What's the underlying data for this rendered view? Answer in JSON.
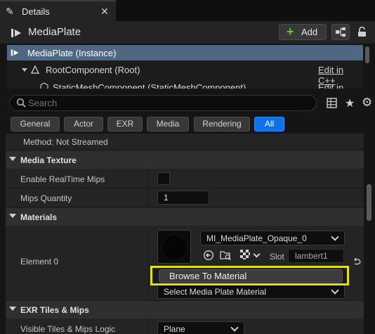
{
  "tab": {
    "title": "Details",
    "icon": "pencil-icon",
    "close": "✕"
  },
  "header": {
    "title": "MediaPlate",
    "add_label": "Add",
    "add_symbol": "+"
  },
  "tree": {
    "rows": [
      {
        "label": "MediaPlate (Instance)",
        "edit": ""
      },
      {
        "label": "RootComponent (Root)",
        "edit": "Edit in C++"
      },
      {
        "label": "StaticMeshComponent (StaticMeshComponent)",
        "edit": "Edit in C++"
      }
    ]
  },
  "search": {
    "placeholder": "Search"
  },
  "filters": [
    "General",
    "Actor",
    "EXR",
    "Media",
    "Rendering",
    "All"
  ],
  "active_filter": "All",
  "properties": {
    "method_text": "Method: Not Streamed",
    "media_texture": {
      "title": "Media Texture",
      "enable_realtime_mips_label": "Enable RealTime Mips",
      "enable_realtime_mips_checked": false,
      "mips_quantity_label": "Mips Quantity",
      "mips_quantity_value": "1"
    },
    "materials": {
      "title": "Materials",
      "element_label": "Element 0",
      "material_value": "MI_MediaPlate_Opaque_0",
      "slot_label": "Slot",
      "slot_value": "lambert1",
      "popup_item": "Browse To Material",
      "select_material_label": "Select Media Plate Material"
    },
    "exr": {
      "title": "EXR Tiles & Mips",
      "visible_tiles_label": "Visible Tiles & Mips Logic",
      "visible_tiles_value": "Plane"
    }
  },
  "colors": {
    "accent": "#0e71e8",
    "selection": "#4f6782",
    "highlight": "#e5dd18",
    "add_plus": "#6bc04b"
  }
}
